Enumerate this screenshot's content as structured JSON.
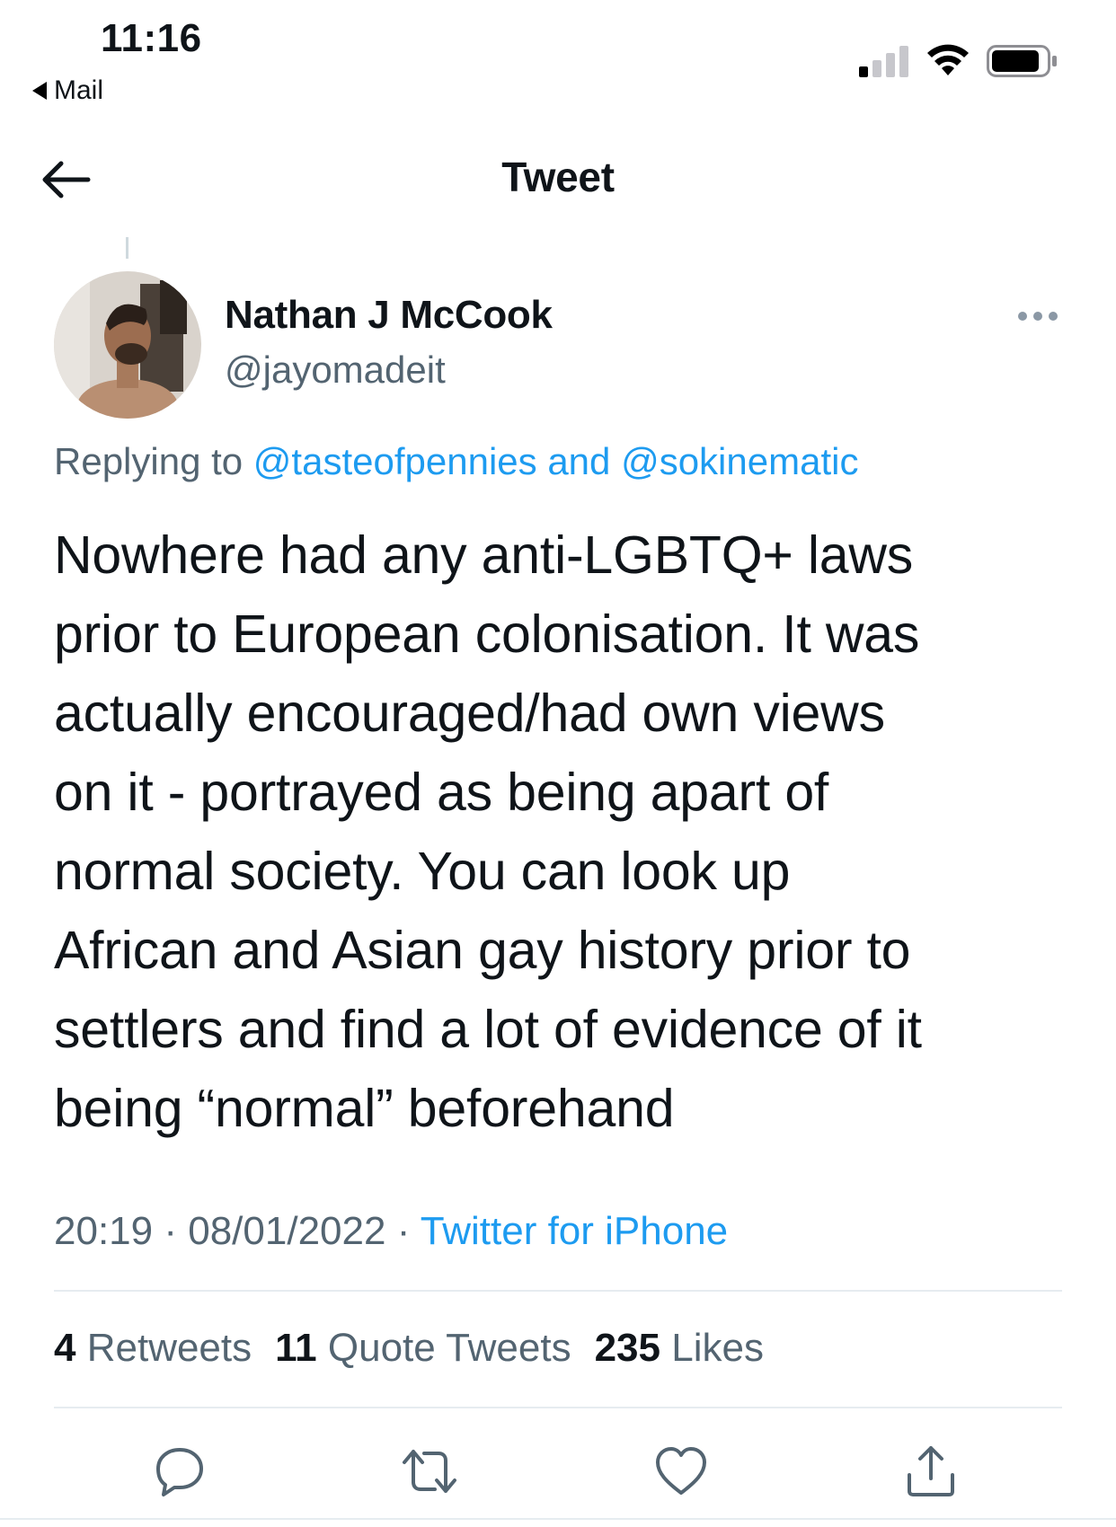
{
  "status_bar": {
    "time": "11:16",
    "back_app": "Mail"
  },
  "nav": {
    "title": "Tweet"
  },
  "tweet": {
    "author_name": "Nathan J McCook",
    "author_handle": "@jayomadeit",
    "replying_label": "Replying to",
    "mention_1": "@tasteofpennies",
    "replying_and": "and",
    "mention_2": "@sokinematic",
    "text_lines": [
      "Nowhere had any anti-LGBTQ+ laws",
      "prior to European colonisation. It was",
      "actually encouraged/had own views",
      "on it - portrayed as being apart of",
      "normal society. You can look up",
      "African and Asian gay history prior to",
      "settlers and find a lot of evidence of it",
      "being “normal” beforehand"
    ],
    "time": "20:19",
    "separator": "·",
    "date": "08/01/2022",
    "source": "Twitter for iPhone"
  },
  "stats": {
    "retweets_count": "4",
    "retweets_label": "Retweets",
    "quotes_count": "11",
    "quotes_label": "Quote Tweets",
    "likes_count": "235",
    "likes_label": "Likes"
  },
  "colors": {
    "accent": "#1d9bf0",
    "secondary_text": "#536471",
    "primary_text": "#0f1419"
  },
  "icons": {
    "signal": "cellular-signal-icon",
    "wifi": "wifi-icon",
    "battery": "battery-icon",
    "back": "arrow-left-icon",
    "more": "more-dots-icon",
    "reply": "reply-icon",
    "retweet": "retweet-icon",
    "like": "heart-icon",
    "share": "share-icon"
  }
}
